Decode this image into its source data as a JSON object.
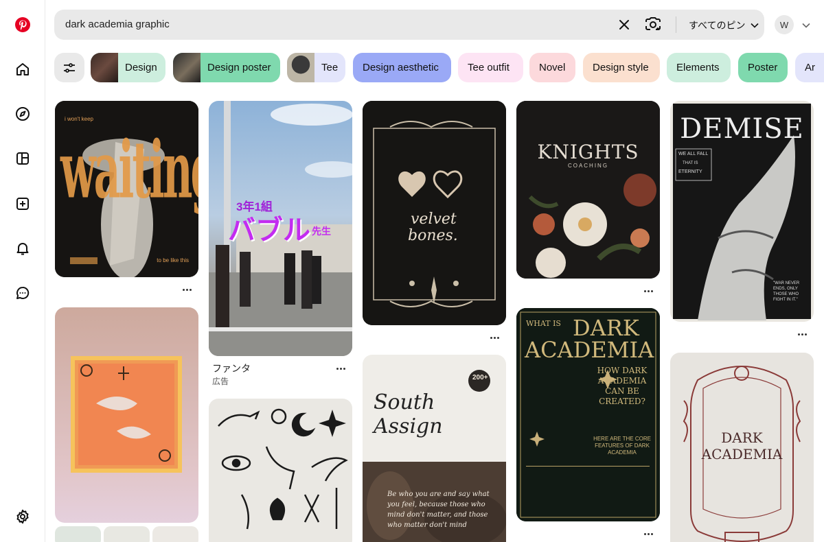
{
  "header": {
    "search_value": "dark academia graphic",
    "filter_label": "すべてのピン",
    "avatar_initial": "W"
  },
  "sidebar": {
    "items": [
      "home-icon",
      "explore-icon",
      "boards-icon",
      "create-icon",
      "notifications-icon",
      "messages-icon",
      "settings-icon"
    ]
  },
  "chips": [
    {
      "label": "Design",
      "bg": "#cdeede"
    },
    {
      "label": "Design poster",
      "bg": "#7fd9ae"
    },
    {
      "label": "Tee",
      "bg": "#e3e5fb"
    },
    {
      "label": "Design aesthetic",
      "bg": "#9aa9f6"
    },
    {
      "label": "Tee outfit",
      "bg": "#fde4f4"
    },
    {
      "label": "Novel",
      "bg": "#fcd9dc"
    },
    {
      "label": "Design style",
      "bg": "#fbe0cf"
    },
    {
      "label": "Elements",
      "bg": "#cdeede"
    },
    {
      "label": "Poster",
      "bg": "#7fd9ae"
    },
    {
      "label": "Ar",
      "bg": "#e3e5fb"
    }
  ],
  "pins": {
    "waiting": {
      "top": "i won't keep",
      "main": "waiting",
      "bottom": "to be like this"
    },
    "bubble": {
      "line1": "3年1組",
      "line2": "バブル",
      "line3": "先生",
      "title": "ファンタ",
      "sub": "広告"
    },
    "velvet": {
      "main1": "velvet",
      "main2": "bones."
    },
    "knights": {
      "title": "KNIGHTS",
      "sub": "COACHING"
    },
    "demise": {
      "title": "DEMISE",
      "tag1": "WE ALL FALL",
      "tag2": "THAT IS",
      "tag3": "ETERNITY",
      "quote": "\"WAR NEVER ENDS, ONLY THOSE WHO FIGHT IN IT.\""
    },
    "darkacademia": {
      "what": "WHAT IS",
      "big1": "DARK",
      "big2": "ACADEMIA",
      "how": "HOW DARK ACADEMIA CAN BE CREATED?",
      "core": "HERE ARE THE CORE FEATURES OF DARK ACADEMIA"
    },
    "frame": {
      "line1": "DARK",
      "line2": "ACADEMIA"
    },
    "south": {
      "title": "South Assign",
      "badge": "200+",
      "quote": "Be who you are and say what you feel, because those who mind don't matter, and those who matter don't mind"
    }
  }
}
